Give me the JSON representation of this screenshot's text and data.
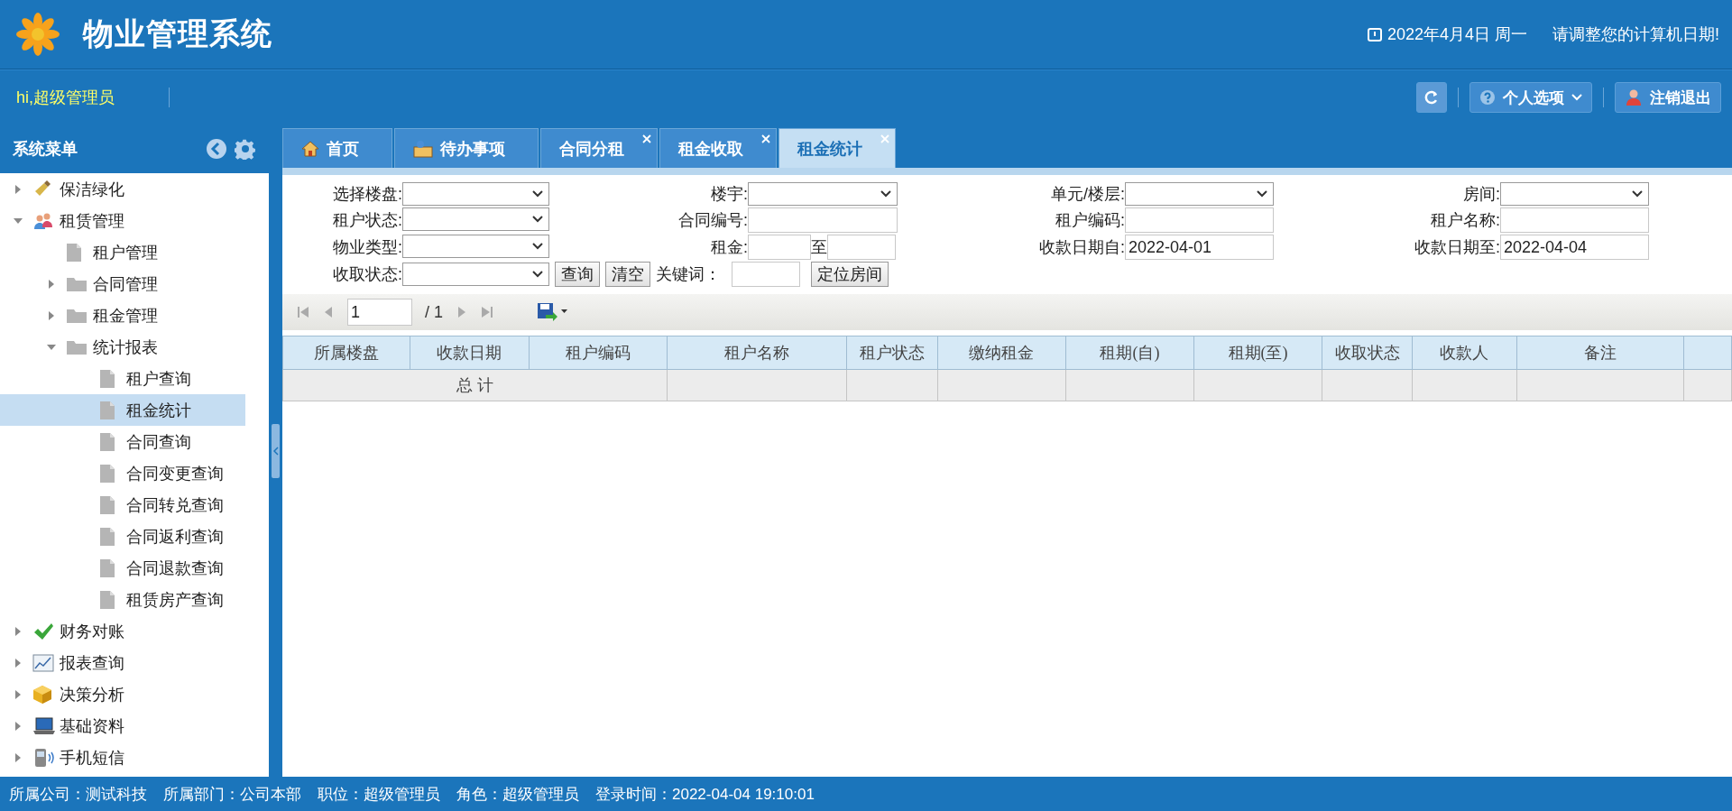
{
  "header": {
    "title": "物业管理系统",
    "date": "2022年4月4日 周一",
    "notice": "请调整您的计算机日期!"
  },
  "userbar": {
    "greeting": "hi,超级管理员",
    "buttons": [
      {
        "kind": "refresh"
      },
      {
        "kind": "options",
        "label": "个人选项"
      },
      {
        "kind": "logout",
        "label": "注销退出"
      }
    ]
  },
  "sidebar": {
    "title": "系统菜单",
    "items": [
      {
        "label": "保洁绿化",
        "kind": "broom",
        "expanded": false,
        "selected": false
      },
      {
        "label": "租赁管理",
        "kind": "people",
        "expanded": true,
        "selected": false,
        "children": [
          {
            "label": "租户管理",
            "kind": "page",
            "selected": false
          },
          {
            "label": "合同管理",
            "kind": "folder",
            "expanded": false,
            "selected": false
          },
          {
            "label": "租金管理",
            "kind": "folder",
            "expanded": false,
            "selected": false
          },
          {
            "label": "统计报表",
            "kind": "folder",
            "expanded": true,
            "selected": false,
            "children": [
              {
                "label": "租户查询",
                "kind": "page",
                "selected": false
              },
              {
                "label": "租金统计",
                "kind": "page",
                "selected": true
              },
              {
                "label": "合同查询",
                "kind": "page",
                "selected": false
              },
              {
                "label": "合同变更查询",
                "kind": "page",
                "selected": false
              },
              {
                "label": "合同转兑查询",
                "kind": "page",
                "selected": false
              },
              {
                "label": "合同返利查询",
                "kind": "page",
                "selected": false
              },
              {
                "label": "合同退款查询",
                "kind": "page",
                "selected": false
              },
              {
                "label": "租赁房产查询",
                "kind": "page",
                "selected": false
              }
            ]
          }
        ]
      },
      {
        "label": "财务对账",
        "kind": "check",
        "expanded": false,
        "selected": false
      },
      {
        "label": "报表查询",
        "kind": "chart",
        "expanded": false,
        "selected": false
      },
      {
        "label": "决策分析",
        "kind": "cube",
        "expanded": false,
        "selected": false
      },
      {
        "label": "基础资料",
        "kind": "computer",
        "expanded": false,
        "selected": false
      },
      {
        "label": "手机短信",
        "kind": "phone",
        "expanded": false,
        "selected": false
      }
    ]
  },
  "tabs": [
    {
      "label": "首页",
      "kind": "home",
      "closable": false,
      "selected": false
    },
    {
      "label": "待办事项",
      "kind": "inbox",
      "closable": false,
      "selected": false
    },
    {
      "label": "合同分租",
      "kind": "plain",
      "closable": true,
      "selected": false
    },
    {
      "label": "租金收取",
      "kind": "plain",
      "closable": true,
      "selected": false
    },
    {
      "label": "租金统计",
      "kind": "plain",
      "closable": true,
      "selected": true
    }
  ],
  "filters": {
    "rows": [
      [
        {
          "label": "选择楼盘:",
          "kind": "select"
        },
        {
          "label": "楼宇:",
          "kind": "select"
        },
        {
          "label": "单元/楼层:",
          "kind": "select"
        },
        {
          "label": "房间:",
          "kind": "select"
        }
      ],
      [
        {
          "label": "租户状态:",
          "kind": "select"
        },
        {
          "label": "合同编号:",
          "kind": "input"
        },
        {
          "label": "租户编码:",
          "kind": "input"
        },
        {
          "label": "租户名称:",
          "kind": "input"
        }
      ],
      [
        {
          "label": "物业类型:",
          "kind": "select"
        },
        {
          "label": "租金:",
          "kind": "range",
          "separator": "至"
        },
        {
          "label": "收款日期自:",
          "kind": "input",
          "value": "2022-04-01"
        },
        {
          "label": "收款日期至:",
          "kind": "input",
          "value": "2022-04-04"
        }
      ]
    ],
    "last_row": {
      "label": "收取状态:",
      "buttons": [
        "查询",
        "清空"
      ],
      "keyword_label": "关键词：",
      "locate_button": "定位房间"
    }
  },
  "pager": {
    "page": "1",
    "total": "/ 1"
  },
  "table": {
    "columns": [
      "所属楼盘",
      "收款日期",
      "租户编码",
      "租户名称",
      "租户状态",
      "缴纳租金",
      "租期(自)",
      "租期(至)",
      "收取状态",
      "收款人",
      "备注"
    ],
    "total_label": "总 计"
  },
  "status_bar": [
    "所属公司：测试科技",
    "所属部门：公司本部",
    "职位：超级管理员",
    "角色：超级管理员",
    "登录时间：2022-04-04 19:10:01"
  ]
}
